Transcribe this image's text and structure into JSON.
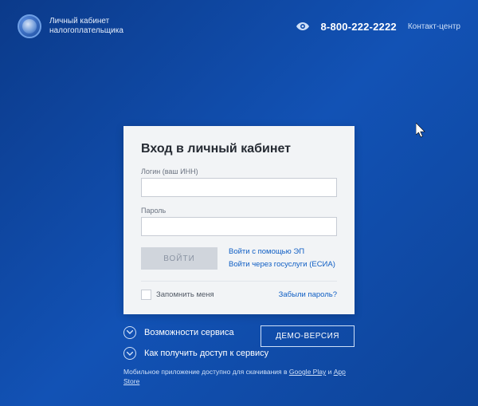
{
  "header": {
    "brand_line1": "Личный кабинет",
    "brand_line2": "налогоплательщика",
    "phone": "8-800-222-2222",
    "contact_center": "Контакт-центр"
  },
  "card": {
    "title": "Вход в личный кабинет",
    "login_label": "Логин (ваш ИНН)",
    "password_label": "Пароль",
    "login_btn": "ВОЙТИ",
    "alt_ep": "Войти с помощью ЭП",
    "alt_esia": "Войти через госуслуги (ЕСИА)",
    "remember": "Запомнить меня",
    "forgot": "Забыли пароль?"
  },
  "below": {
    "features": "Возможности сервиса",
    "howto": "Как получить доступ к сервису",
    "demo": "ДЕМО-ВЕРСИЯ",
    "app_prefix": "Мобильное приложение доступно для скачивания в ",
    "gp": "Google Play",
    "and": " и ",
    "as": "App Store"
  }
}
